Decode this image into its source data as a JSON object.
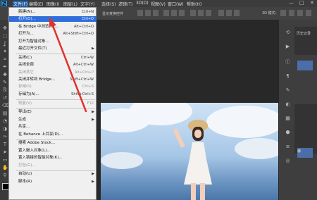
{
  "menubar": {
    "logo": "Ps",
    "items": [
      "文件(F)",
      "编辑(E)",
      "图像(I)",
      "图层(L)",
      "文字(Y)",
      "选择(S)",
      "滤镜(T)",
      "3D(D)",
      "视图(V)",
      "窗口(W)",
      "帮助(H)"
    ],
    "window_controls": [
      "—",
      "□",
      "✕"
    ]
  },
  "optionbar": {
    "show_transform_label": "显示变换控件",
    "mode3d_label": "3D 模式："
  },
  "file_menu": {
    "items": [
      {
        "label": "新建(N)...",
        "shortcut": "Ctrl+N",
        "disabled": false,
        "highlight": false
      },
      {
        "label": "打开(O)...",
        "shortcut": "Ctrl+O",
        "disabled": false,
        "highlight": true
      },
      {
        "label": "在 Bridge 中浏览(B)...",
        "shortcut": "Alt+Ctrl+O",
        "disabled": false,
        "highlight": false
      },
      {
        "label": "打开为...",
        "shortcut": "Alt+Shift+Ctrl+O",
        "disabled": false,
        "highlight": false
      },
      {
        "label": "打开为智能对象...",
        "shortcut": "",
        "disabled": false,
        "highlight": false
      },
      {
        "label": "最近打开文件(T)",
        "shortcut": "",
        "submenu": true,
        "disabled": false,
        "highlight": false
      },
      {
        "label": "关闭(C)",
        "shortcut": "Ctrl+W",
        "disabled": false,
        "highlight": false
      },
      {
        "label": "关闭全部",
        "shortcut": "Alt+Ctrl+W",
        "disabled": false,
        "highlight": false
      },
      {
        "label": "关闭其它",
        "shortcut": "Alt+Ctrl+P",
        "disabled": true,
        "highlight": false
      },
      {
        "label": "关闭并转到 Bridge...",
        "shortcut": "Shift+Ctrl+W",
        "disabled": false,
        "highlight": false
      },
      {
        "label": "存储(S)",
        "shortcut": "Ctrl+S",
        "disabled": true,
        "highlight": false
      },
      {
        "label": "存储为(A)...",
        "shortcut": "Shift+Ctrl+S",
        "disabled": false,
        "highlight": false
      },
      {
        "label": "恢复(V)",
        "shortcut": "F12",
        "disabled": true,
        "highlight": false
      },
      {
        "label": "导出(E)",
        "shortcut": "",
        "submenu": true,
        "disabled": false,
        "highlight": false
      },
      {
        "label": "生成",
        "shortcut": "",
        "submenu": true,
        "disabled": false,
        "highlight": false
      },
      {
        "label": "共享...",
        "shortcut": "",
        "disabled": false,
        "highlight": false
      },
      {
        "label": "在 Behance 上共享(D)...",
        "shortcut": "",
        "disabled": false,
        "highlight": false
      },
      {
        "label": "搜索 Adobe Stock...",
        "shortcut": "",
        "disabled": false,
        "highlight": false
      },
      {
        "label": "置入嵌入对象(L)...",
        "shortcut": "",
        "disabled": false,
        "highlight": false
      },
      {
        "label": "置入链接的智能对象(K)...",
        "shortcut": "",
        "disabled": false,
        "highlight": false
      },
      {
        "label": "打包(G)...",
        "shortcut": "",
        "disabled": true,
        "highlight": false
      },
      {
        "label": "自动(U)",
        "shortcut": "",
        "submenu": true,
        "disabled": false,
        "highlight": false
      },
      {
        "label": "脚本(R)",
        "shortcut": "",
        "submenu": true,
        "disabled": false,
        "highlight": false
      }
    ]
  },
  "colors": {
    "highlight": "#2f6fdb",
    "annotation_arrow": "#e0322b"
  },
  "tools": [
    "move-icon",
    "marquee-icon",
    "lasso-icon",
    "quick-select-icon",
    "crop-icon",
    "eyedropper-icon",
    "healing-icon",
    "brush-icon",
    "stamp-icon",
    "history-brush-icon",
    "eraser-icon",
    "gradient-icon",
    "blur-icon",
    "dodge-icon",
    "pen-icon",
    "text-icon",
    "path-select-icon",
    "shape-icon",
    "hand-icon",
    "zoom-icon"
  ],
  "right_panel": {
    "title": "历史记录"
  }
}
